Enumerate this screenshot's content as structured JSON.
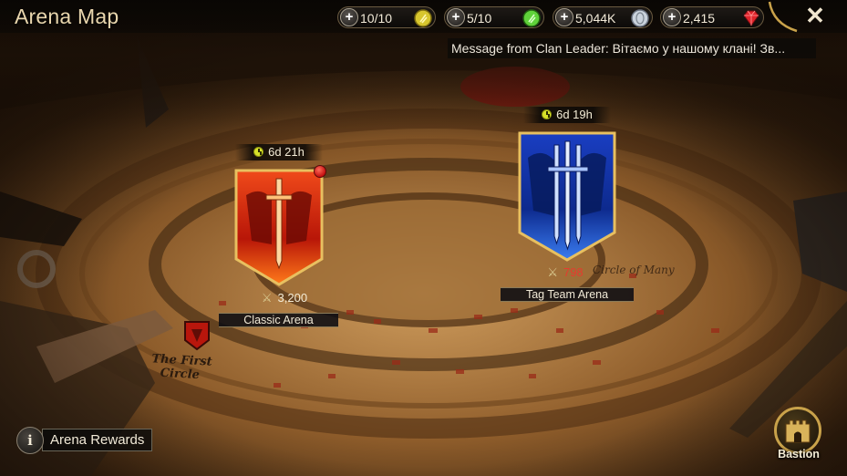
{
  "header": {
    "title": "Arena Map",
    "close_label": "✕"
  },
  "resources": [
    {
      "name": "energy",
      "value": "10/10",
      "icon": "gold-energy-icon",
      "color": "#d7c62e"
    },
    {
      "name": "arena-tokens",
      "value": "5/10",
      "icon": "green-token-icon",
      "color": "#5fd23a"
    },
    {
      "name": "silver",
      "value": "5,044K",
      "icon": "silver-coin-icon",
      "color": "#c9d2dc"
    },
    {
      "name": "gems",
      "value": "2,415",
      "icon": "ruby-gem-icon",
      "color": "#e0252c"
    }
  ],
  "message": {
    "text": "Message from Clan Leader: Вітаємо у нашому клані! Зв..."
  },
  "arenas": {
    "classic": {
      "timer": "6d 21h",
      "score": "3,200",
      "label": "Classic Arena",
      "color": "#d4300f"
    },
    "tag_team": {
      "timer": "6d 19h",
      "score": "798",
      "label": "Tag Team Arena",
      "color": "#1d4fd6"
    }
  },
  "map_text": {
    "first_circle_line1": "The First",
    "first_circle_line2": "Circle",
    "circle_of_many": "Circle of Many"
  },
  "bottom": {
    "rewards_label": "Arena Rewards",
    "info_label": "i",
    "bastion_label": "Bastion"
  }
}
